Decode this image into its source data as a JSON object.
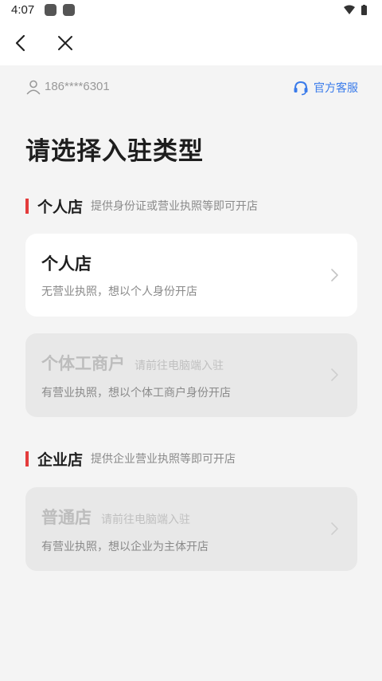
{
  "status_bar": {
    "time": "4:07"
  },
  "account": {
    "phone": "186****6301",
    "service_label": "官方客服"
  },
  "page": {
    "title": "请选择入驻类型"
  },
  "sections": [
    {
      "title": "个人店",
      "subtitle": "提供身份证或营业执照等即可开店",
      "cards": [
        {
          "title": "个人店",
          "hint": "",
          "description": "无营业执照，想以个人身份开店",
          "enabled": true
        },
        {
          "title": "个体工商户",
          "hint": "请前往电脑端入驻",
          "description": "有营业执照，想以个体工商户身份开店",
          "enabled": false
        }
      ]
    },
    {
      "title": "企业店",
      "subtitle": "提供企业营业执照等即可开店",
      "cards": [
        {
          "title": "普通店",
          "hint": "请前往电脑端入驻",
          "description": "有营业执照，想以企业为主体开店",
          "enabled": false
        }
      ]
    }
  ],
  "colors": {
    "accent": "#3a7bea",
    "section_marker": "#e43c3c",
    "disabled_card": "#e8e8e8"
  }
}
